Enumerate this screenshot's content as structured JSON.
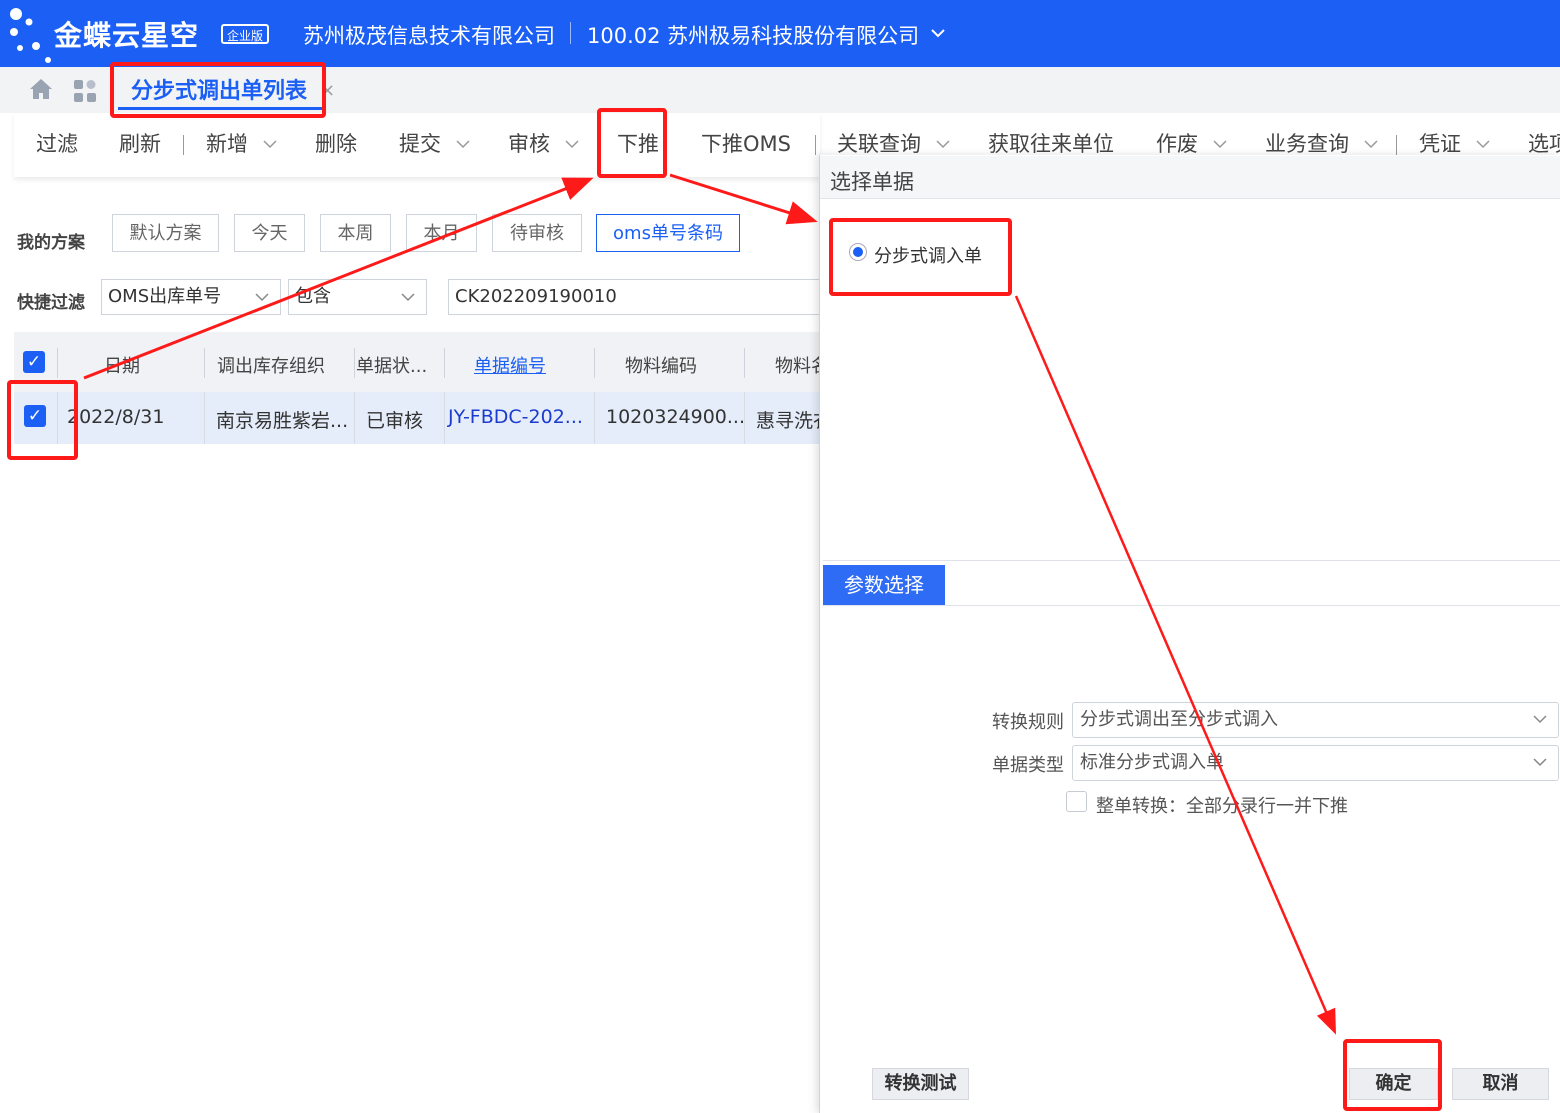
{
  "header": {
    "logo_text": "金蝶云星空",
    "logo_badge": "企业版",
    "company_left": "苏州极茂信息技术有限公司",
    "company_right": "100.02 苏州极易科技股份有限公司"
  },
  "tabs": {
    "active_label": "分步式调出单列表",
    "close_glyph": "×"
  },
  "toolbar": {
    "filter": "过滤",
    "refresh": "刷新",
    "add": "新增",
    "delete": "删除",
    "submit": "提交",
    "audit": "审核",
    "push_down": "下推",
    "push_oms": "下推OMS",
    "related_query": "关联查询",
    "get_contacts": "获取往来单位",
    "void": "作废",
    "business_query": "业务查询",
    "voucher": "凭证",
    "options": "选项"
  },
  "schemes": {
    "label": "我的方案",
    "items": [
      "默认方案",
      "今天",
      "本周",
      "本月",
      "待审核",
      "oms单号条码"
    ]
  },
  "quick_filter": {
    "label": "快捷过滤",
    "field": "OMS出库单号",
    "operator": "包含",
    "value": "CK202209190010"
  },
  "grid": {
    "columns": [
      "日期",
      "调出库存组织",
      "单据状...",
      "单据编号",
      "物料编码",
      "物料名"
    ],
    "rows": [
      {
        "date": "2022/8/31",
        "org": "南京易胜紫岩...",
        "status": "已审核",
        "bill_no": "JY-FBDC-202...",
        "material_code": "1020324900...",
        "material_name": "惠寻洗衣"
      }
    ]
  },
  "dialog": {
    "title": "选择单据",
    "radio_option": "分步式调入单",
    "param_tab": "参数选择",
    "rule_label": "转换规则",
    "rule_value": "分步式调出至分步式调入",
    "type_label": "单据类型",
    "type_value": "标准分步式调入单",
    "whole_label": "整单转换：全部分录行一并下推",
    "btn_test": "转换测试",
    "btn_ok": "确定",
    "btn_cancel": "取消"
  },
  "colors": {
    "brand_blue": "#1b5ff5",
    "annotation_red": "#ff1a1a"
  }
}
